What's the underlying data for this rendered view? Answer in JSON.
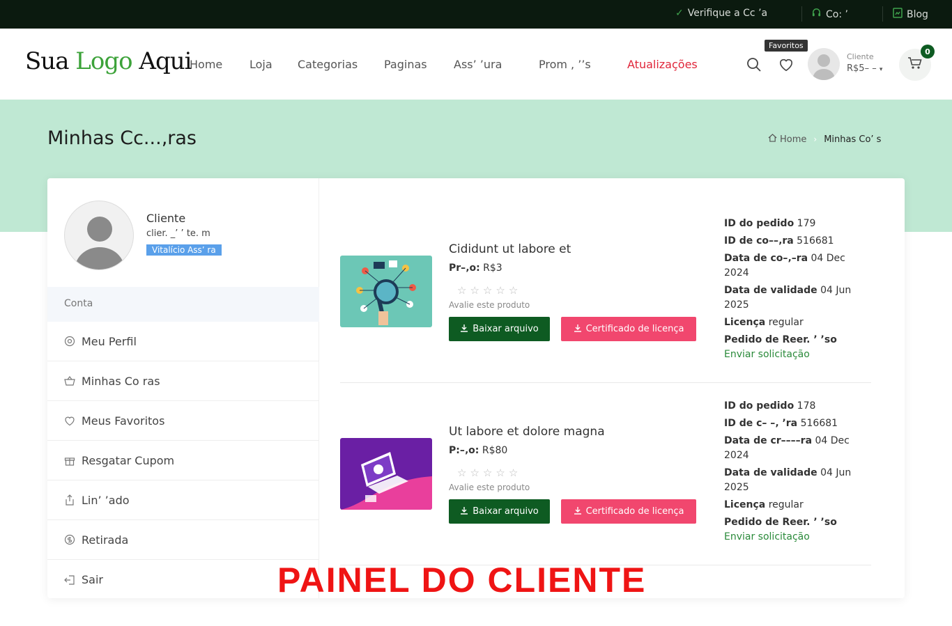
{
  "topbar": {
    "verify_label": "Verifique a Cc   ’a",
    "contact_label": "Co:   ’",
    "blog_label": "Blog"
  },
  "header": {
    "logo_part1": "Sua ",
    "logo_part2": "Logo",
    "logo_part3": " Aqui",
    "nav": [
      "Home",
      "Loja",
      "Categorias",
      "Paginas",
      "Ass’  ’ura",
      "Prom  ,  ’’s",
      "Atualizações"
    ],
    "favorites_tooltip": "Favoritos",
    "user_label": "Cliente",
    "user_balance": "R$5– –",
    "cart_count": "0"
  },
  "banner": {
    "title": "Minhas Cc...‚ras",
    "breadcrumb_home": "Home",
    "breadcrumb_current": "Minhas Co’   s"
  },
  "profile": {
    "name": "Cliente",
    "email": "clier.  _’  ’  te.   m",
    "badge": "Vitalício Ass’      ra"
  },
  "menu": {
    "header": "Conta",
    "items": [
      "Meu Perfil",
      "Minhas Co      ras",
      "Meus Favoritos",
      "Resgatar Cupom",
      "Lin’              ’ado",
      "Retirada",
      "Sair"
    ]
  },
  "orders": [
    {
      "title": "Cididunt ut labore et",
      "price_label": "Pr–‚o:",
      "price_value": "R$3",
      "rate_label": "Avalie este produto",
      "download_label": "Baixar arquivo",
      "cert_label": "Certificado de licença",
      "id_label": "ID do pedido",
      "id_value": "179",
      "purchase_id_label": "ID de co––‚ra",
      "purchase_id_value": "516681",
      "date_label": "Data de co–‚–ra",
      "date_value": "04 Dec 2024",
      "validity_label": "Data de validade",
      "validity_value": "04 Jun 2025",
      "license_label": "Licença",
      "license_value": "regular",
      "refund_label": "Pedido de Reer.  ’   ’so",
      "refund_link": "Enviar solicitação"
    },
    {
      "title": "Ut labore et dolore magna",
      "price_label": "P:–‚o:",
      "price_value": "R$80",
      "rate_label": "Avalie este produto",
      "download_label": "Baixar arquivo",
      "cert_label": "Certificado de licença",
      "id_label": "ID do pedido",
      "id_value": "178",
      "purchase_id_label": "ID de c– –‚ ’ra",
      "purchase_id_value": "516681",
      "date_label": "Data de cr––––ra",
      "date_value": "04 Dec 2024",
      "validity_label": "Data de validade",
      "validity_value": "04 Jun 2025",
      "license_label": "Licença",
      "license_value": "regular",
      "refund_label": "Pedido de Reer.  ’   ’so",
      "refund_link": "Enviar solicitação"
    }
  ],
  "overlay": "PAINEL DO CLIENTE",
  "colors": {
    "brand_green": "#0e5b22",
    "accent_red": "#e0263a",
    "cert_pink": "#f1476e",
    "banner_mint": "#bfe8d3",
    "badge_blue": "#5aa0ea"
  },
  "icons": [
    "check-icon",
    "headset-icon",
    "blog-icon",
    "search-icon",
    "heart-icon",
    "cart-icon",
    "home-icon",
    "gear-icon",
    "basket-icon",
    "gift-icon",
    "share-icon",
    "coin-icon",
    "logout-icon",
    "download-icon",
    "star-icon"
  ]
}
